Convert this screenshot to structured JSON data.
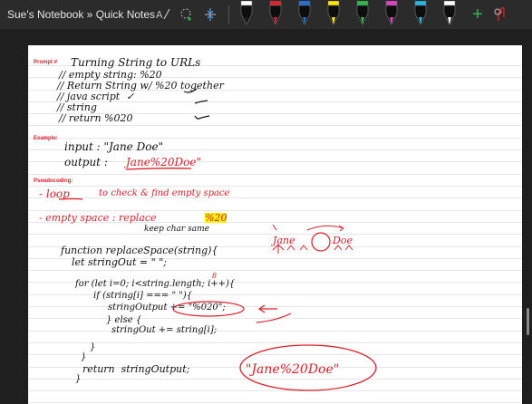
{
  "header": {
    "breadcrumb": "Sue's Notebook » Quick Notes"
  },
  "toolbar": {
    "pens": [
      {
        "name": "pen-black-1",
        "color": "#1a1a1a",
        "band": "#ffffff"
      },
      {
        "name": "pen-red",
        "color": "#e0202a",
        "band": "#e0202a"
      },
      {
        "name": "pen-blue",
        "color": "#1e6fd9",
        "band": "#1e6fd9"
      },
      {
        "name": "pen-yellow",
        "color": "#ffe600",
        "band": "#ffe600"
      },
      {
        "name": "pen-green",
        "color": "#2fb84a",
        "band": "#2fb84a"
      },
      {
        "name": "pen-magenta",
        "color": "#e040c8",
        "band": "#e040c8"
      },
      {
        "name": "pen-cyan",
        "color": "#23b7e5",
        "band": "#23b7e5"
      },
      {
        "name": "pen-white",
        "color": "#ffffff",
        "band": "#ffffff"
      }
    ],
    "add_label": "+",
    "accent": "#2fb84a"
  },
  "sections": {
    "prompt_tag": "Prompt #",
    "example_tag": "Example:",
    "pseudo_tag": "Pseudocoding:"
  },
  "notes": {
    "title": "Turning String to URLs",
    "line1": "// empty string: %20",
    "line2": "// Return String w/ %20 together",
    "line3": "// java script  ✓",
    "line4": "// string",
    "line5": "// return %020",
    "input_label": "input : \"Jane Doe\"",
    "output_label": "output :",
    "output_value": "Jane%20Doe\"",
    "bullet1a": "- loop",
    "bullet1b": "to check & find empty space",
    "bullet2a": "- empty space : replace",
    "bullet2b": "%20",
    "bullet2c": "keep char same",
    "fn1": "function replaceSpace(string){",
    "fn2": "let stringOut = \" \";",
    "fn3": "for (let i=0; i<string.length; i++){",
    "fn4": "if (string[i] === \" \"){",
    "fn5": "stringOutput += \"%020\";",
    "fn6": "} else {",
    "fn7": "stringOut += string[i];",
    "fn8": "}",
    "fn9": "}",
    "fn10": "return  stringOutput;",
    "fn11": "}",
    "result": "\"Jane%20Doe\"",
    "diagram_jane": "Jane",
    "diagram_doe": "Doe",
    "loop_num": "8"
  }
}
